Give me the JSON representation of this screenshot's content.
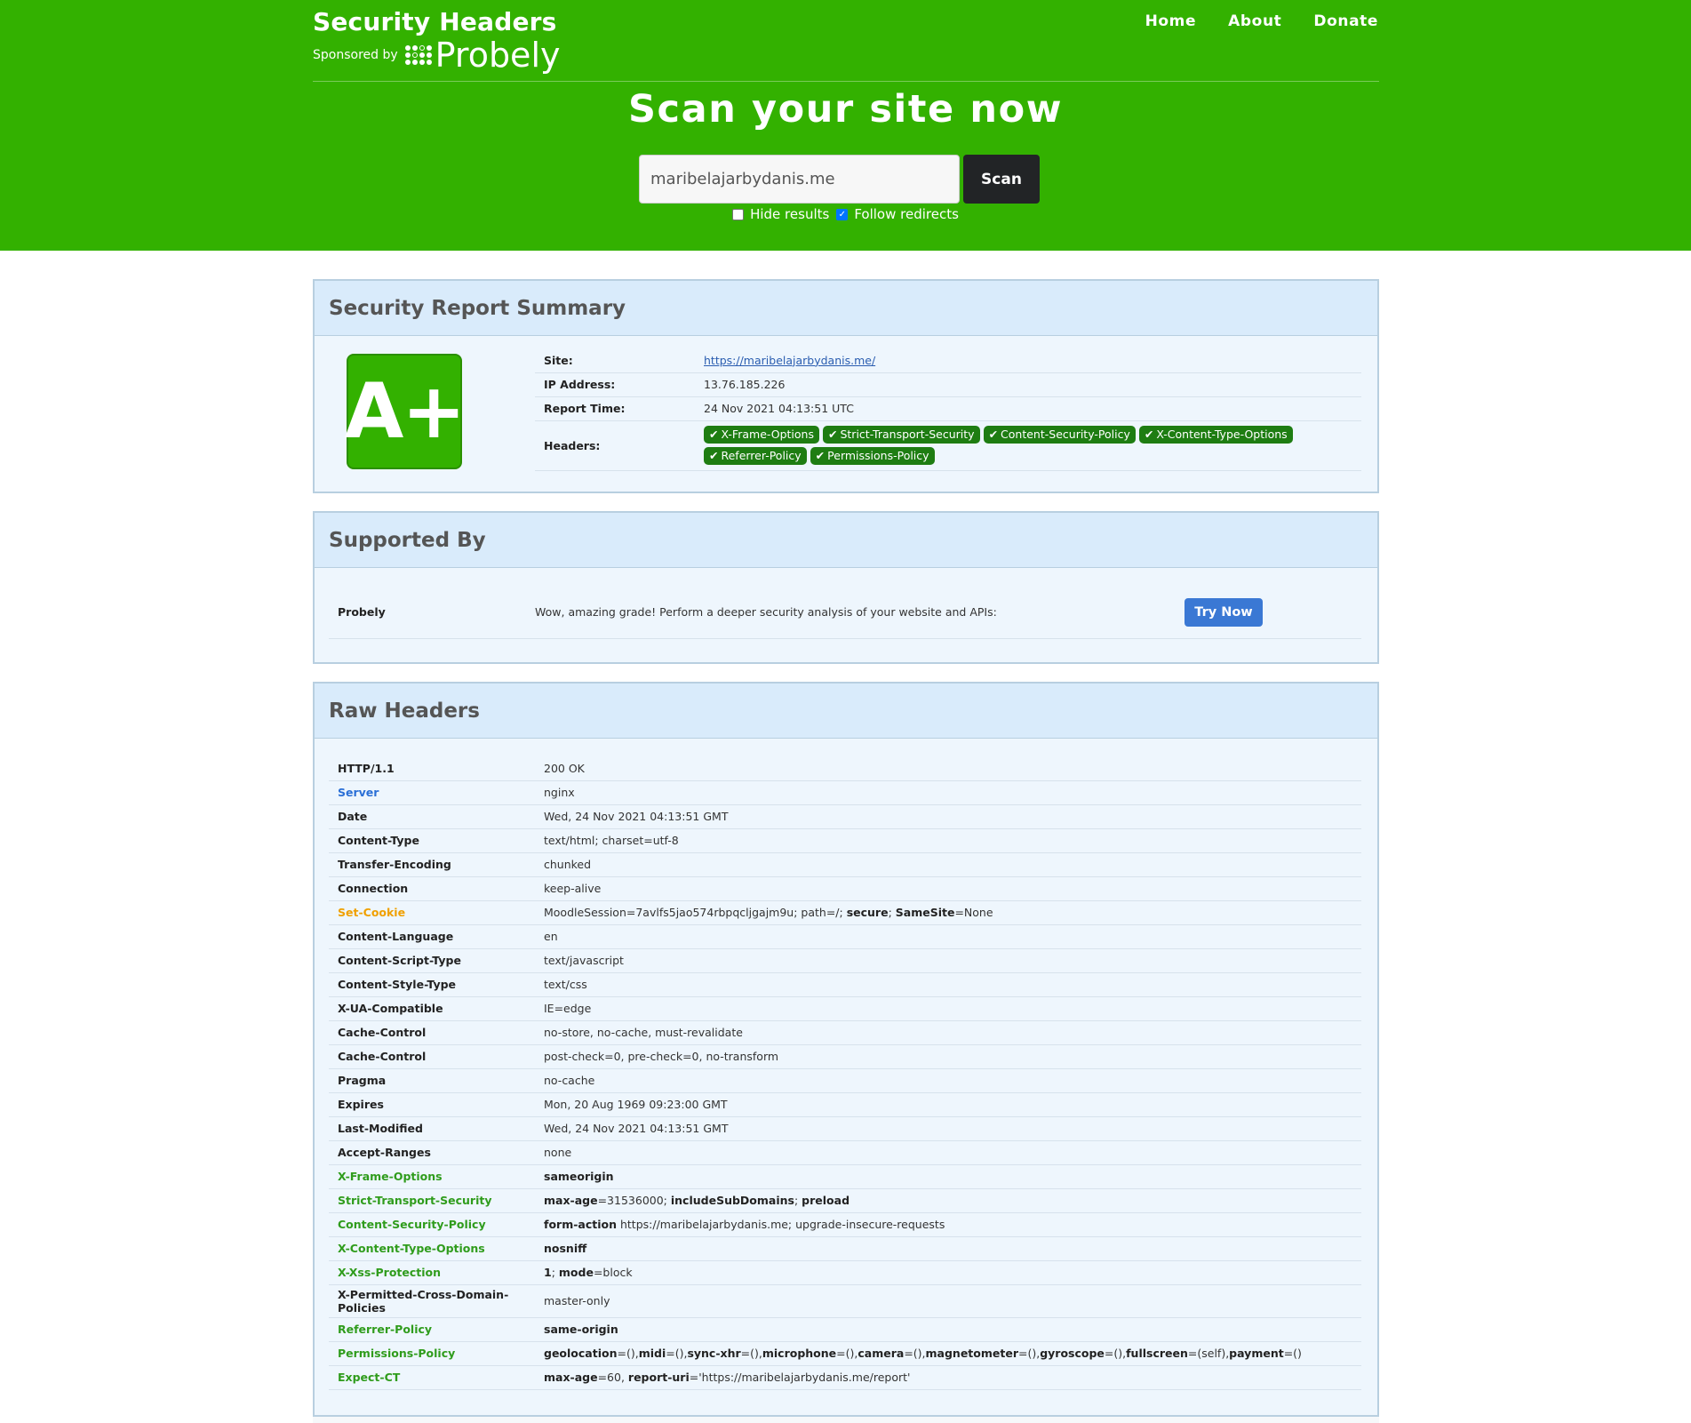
{
  "brand": {
    "title": "Security Headers",
    "sponsored_by": "Sponsored by",
    "sponsor_name": "Probely"
  },
  "nav": {
    "home": "Home",
    "about": "About",
    "donate": "Donate"
  },
  "scan": {
    "title": "Scan your site now",
    "input_value": "maribelajarbydanis.me",
    "button": "Scan",
    "hide_results_label": "Hide results",
    "hide_results_checked": false,
    "follow_redirects_label": "Follow redirects",
    "follow_redirects_checked": true
  },
  "colors": {
    "brand_green": "#33b100",
    "pill_green": "#1e7d12",
    "panel_bg": "#eef6fd",
    "panel_head_bg": "#d9ebfb",
    "good_header": "#2f9c1c",
    "info_header": "#2a6fd6",
    "warn_header": "#f0a000",
    "try_now_button": "#3a78d4"
  },
  "summary": {
    "heading": "Security Report Summary",
    "grade": "A+",
    "site_label": "Site:",
    "site_value": "https://maribelajarbydanis.me/",
    "ip_label": "IP Address:",
    "ip_value": "13.76.185.226",
    "time_label": "Report Time:",
    "time_value": "24 Nov 2021 04:13:51 UTC",
    "headers_label": "Headers:",
    "header_badges": [
      "X-Frame-Options",
      "Strict-Transport-Security",
      "Content-Security-Policy",
      "X-Content-Type-Options",
      "Referrer-Policy",
      "Permissions-Policy"
    ],
    "badge_icon": "checkmark-icon"
  },
  "supported": {
    "heading": "Supported By",
    "name": "Probely",
    "description": "Wow, amazing grade! Perform a deeper security analysis of your website and APIs:",
    "button": "Try Now"
  },
  "raw": {
    "heading": "Raw Headers",
    "rows": [
      {
        "key": "HTTP/1.1",
        "status": "normal",
        "value": [
          {
            "t": "200 OK"
          }
        ]
      },
      {
        "key": "Server",
        "status": "info",
        "value": [
          {
            "t": "nginx"
          }
        ]
      },
      {
        "key": "Date",
        "status": "normal",
        "value": [
          {
            "t": "Wed, 24 Nov 2021 04:13:51 GMT"
          }
        ]
      },
      {
        "key": "Content-Type",
        "status": "normal",
        "value": [
          {
            "t": "text/html; charset=utf-8"
          }
        ]
      },
      {
        "key": "Transfer-Encoding",
        "status": "normal",
        "value": [
          {
            "t": "chunked"
          }
        ]
      },
      {
        "key": "Connection",
        "status": "normal",
        "value": [
          {
            "t": "keep-alive"
          }
        ]
      },
      {
        "key": "Set-Cookie",
        "status": "warn",
        "value": [
          {
            "t": "MoodleSession=7avlfs5jao574rbpqcljgajm9u; path=/; "
          },
          {
            "t": "secure",
            "b": true
          },
          {
            "t": "; "
          },
          {
            "t": "SameSite",
            "b": true
          },
          {
            "t": "=None"
          }
        ]
      },
      {
        "key": "Content-Language",
        "status": "normal",
        "value": [
          {
            "t": "en"
          }
        ]
      },
      {
        "key": "Content-Script-Type",
        "status": "normal",
        "value": [
          {
            "t": "text/javascript"
          }
        ]
      },
      {
        "key": "Content-Style-Type",
        "status": "normal",
        "value": [
          {
            "t": "text/css"
          }
        ]
      },
      {
        "key": "X-UA-Compatible",
        "status": "normal",
        "value": [
          {
            "t": "IE=edge"
          }
        ]
      },
      {
        "key": "Cache-Control",
        "status": "normal",
        "value": [
          {
            "t": "no-store, no-cache, must-revalidate"
          }
        ]
      },
      {
        "key": "Cache-Control",
        "status": "normal",
        "value": [
          {
            "t": "post-check=0, pre-check=0, no-transform"
          }
        ]
      },
      {
        "key": "Pragma",
        "status": "normal",
        "value": [
          {
            "t": "no-cache"
          }
        ]
      },
      {
        "key": "Expires",
        "status": "normal",
        "value": [
          {
            "t": "Mon, 20 Aug 1969 09:23:00 GMT"
          }
        ]
      },
      {
        "key": "Last-Modified",
        "status": "normal",
        "value": [
          {
            "t": "Wed, 24 Nov 2021 04:13:51 GMT"
          }
        ]
      },
      {
        "key": "Accept-Ranges",
        "status": "normal",
        "value": [
          {
            "t": "none"
          }
        ]
      },
      {
        "key": "X-Frame-Options",
        "status": "good",
        "value": [
          {
            "t": "sameorigin",
            "b": true
          }
        ]
      },
      {
        "key": "Strict-Transport-Security",
        "status": "good",
        "value": [
          {
            "t": "max-age",
            "b": true
          },
          {
            "t": "=31536000; "
          },
          {
            "t": "includeSubDomains",
            "b": true
          },
          {
            "t": "; "
          },
          {
            "t": "preload",
            "b": true
          }
        ]
      },
      {
        "key": "Content-Security-Policy",
        "status": "good",
        "value": [
          {
            "t": "form-action",
            "b": true
          },
          {
            "t": " https://maribelajarbydanis.me; upgrade-insecure-requests"
          }
        ]
      },
      {
        "key": "X-Content-Type-Options",
        "status": "good",
        "value": [
          {
            "t": "nosniff",
            "b": true
          }
        ]
      },
      {
        "key": "X-Xss-Protection",
        "status": "good",
        "value": [
          {
            "t": "1",
            "b": true
          },
          {
            "t": "; "
          },
          {
            "t": "mode",
            "b": true
          },
          {
            "t": "=block"
          }
        ]
      },
      {
        "key": "X-Permitted-Cross-Domain-Policies",
        "status": "normal",
        "value": [
          {
            "t": "master-only"
          }
        ]
      },
      {
        "key": "Referrer-Policy",
        "status": "good",
        "value": [
          {
            "t": "same-origin",
            "b": true
          }
        ]
      },
      {
        "key": "Permissions-Policy",
        "status": "good",
        "value": [
          {
            "t": "geolocation",
            "b": true
          },
          {
            "t": "=(),"
          },
          {
            "t": "midi",
            "b": true
          },
          {
            "t": "=(),"
          },
          {
            "t": "sync-xhr",
            "b": true
          },
          {
            "t": "=(),"
          },
          {
            "t": "microphone",
            "b": true
          },
          {
            "t": "=(),"
          },
          {
            "t": "camera",
            "b": true
          },
          {
            "t": "=(),"
          },
          {
            "t": "magnetometer",
            "b": true
          },
          {
            "t": "=(),"
          },
          {
            "t": "gyroscope",
            "b": true
          },
          {
            "t": "=(),"
          },
          {
            "t": "fullscreen",
            "b": true
          },
          {
            "t": "=(self),"
          },
          {
            "t": "payment",
            "b": true
          },
          {
            "t": "=()"
          }
        ]
      },
      {
        "key": "Expect-CT",
        "status": "good",
        "value": [
          {
            "t": "max-age",
            "b": true
          },
          {
            "t": "=60, "
          },
          {
            "t": "report-uri",
            "b": true
          },
          {
            "t": "='https://maribelajarbydanis.me/report'"
          }
        ]
      }
    ]
  }
}
